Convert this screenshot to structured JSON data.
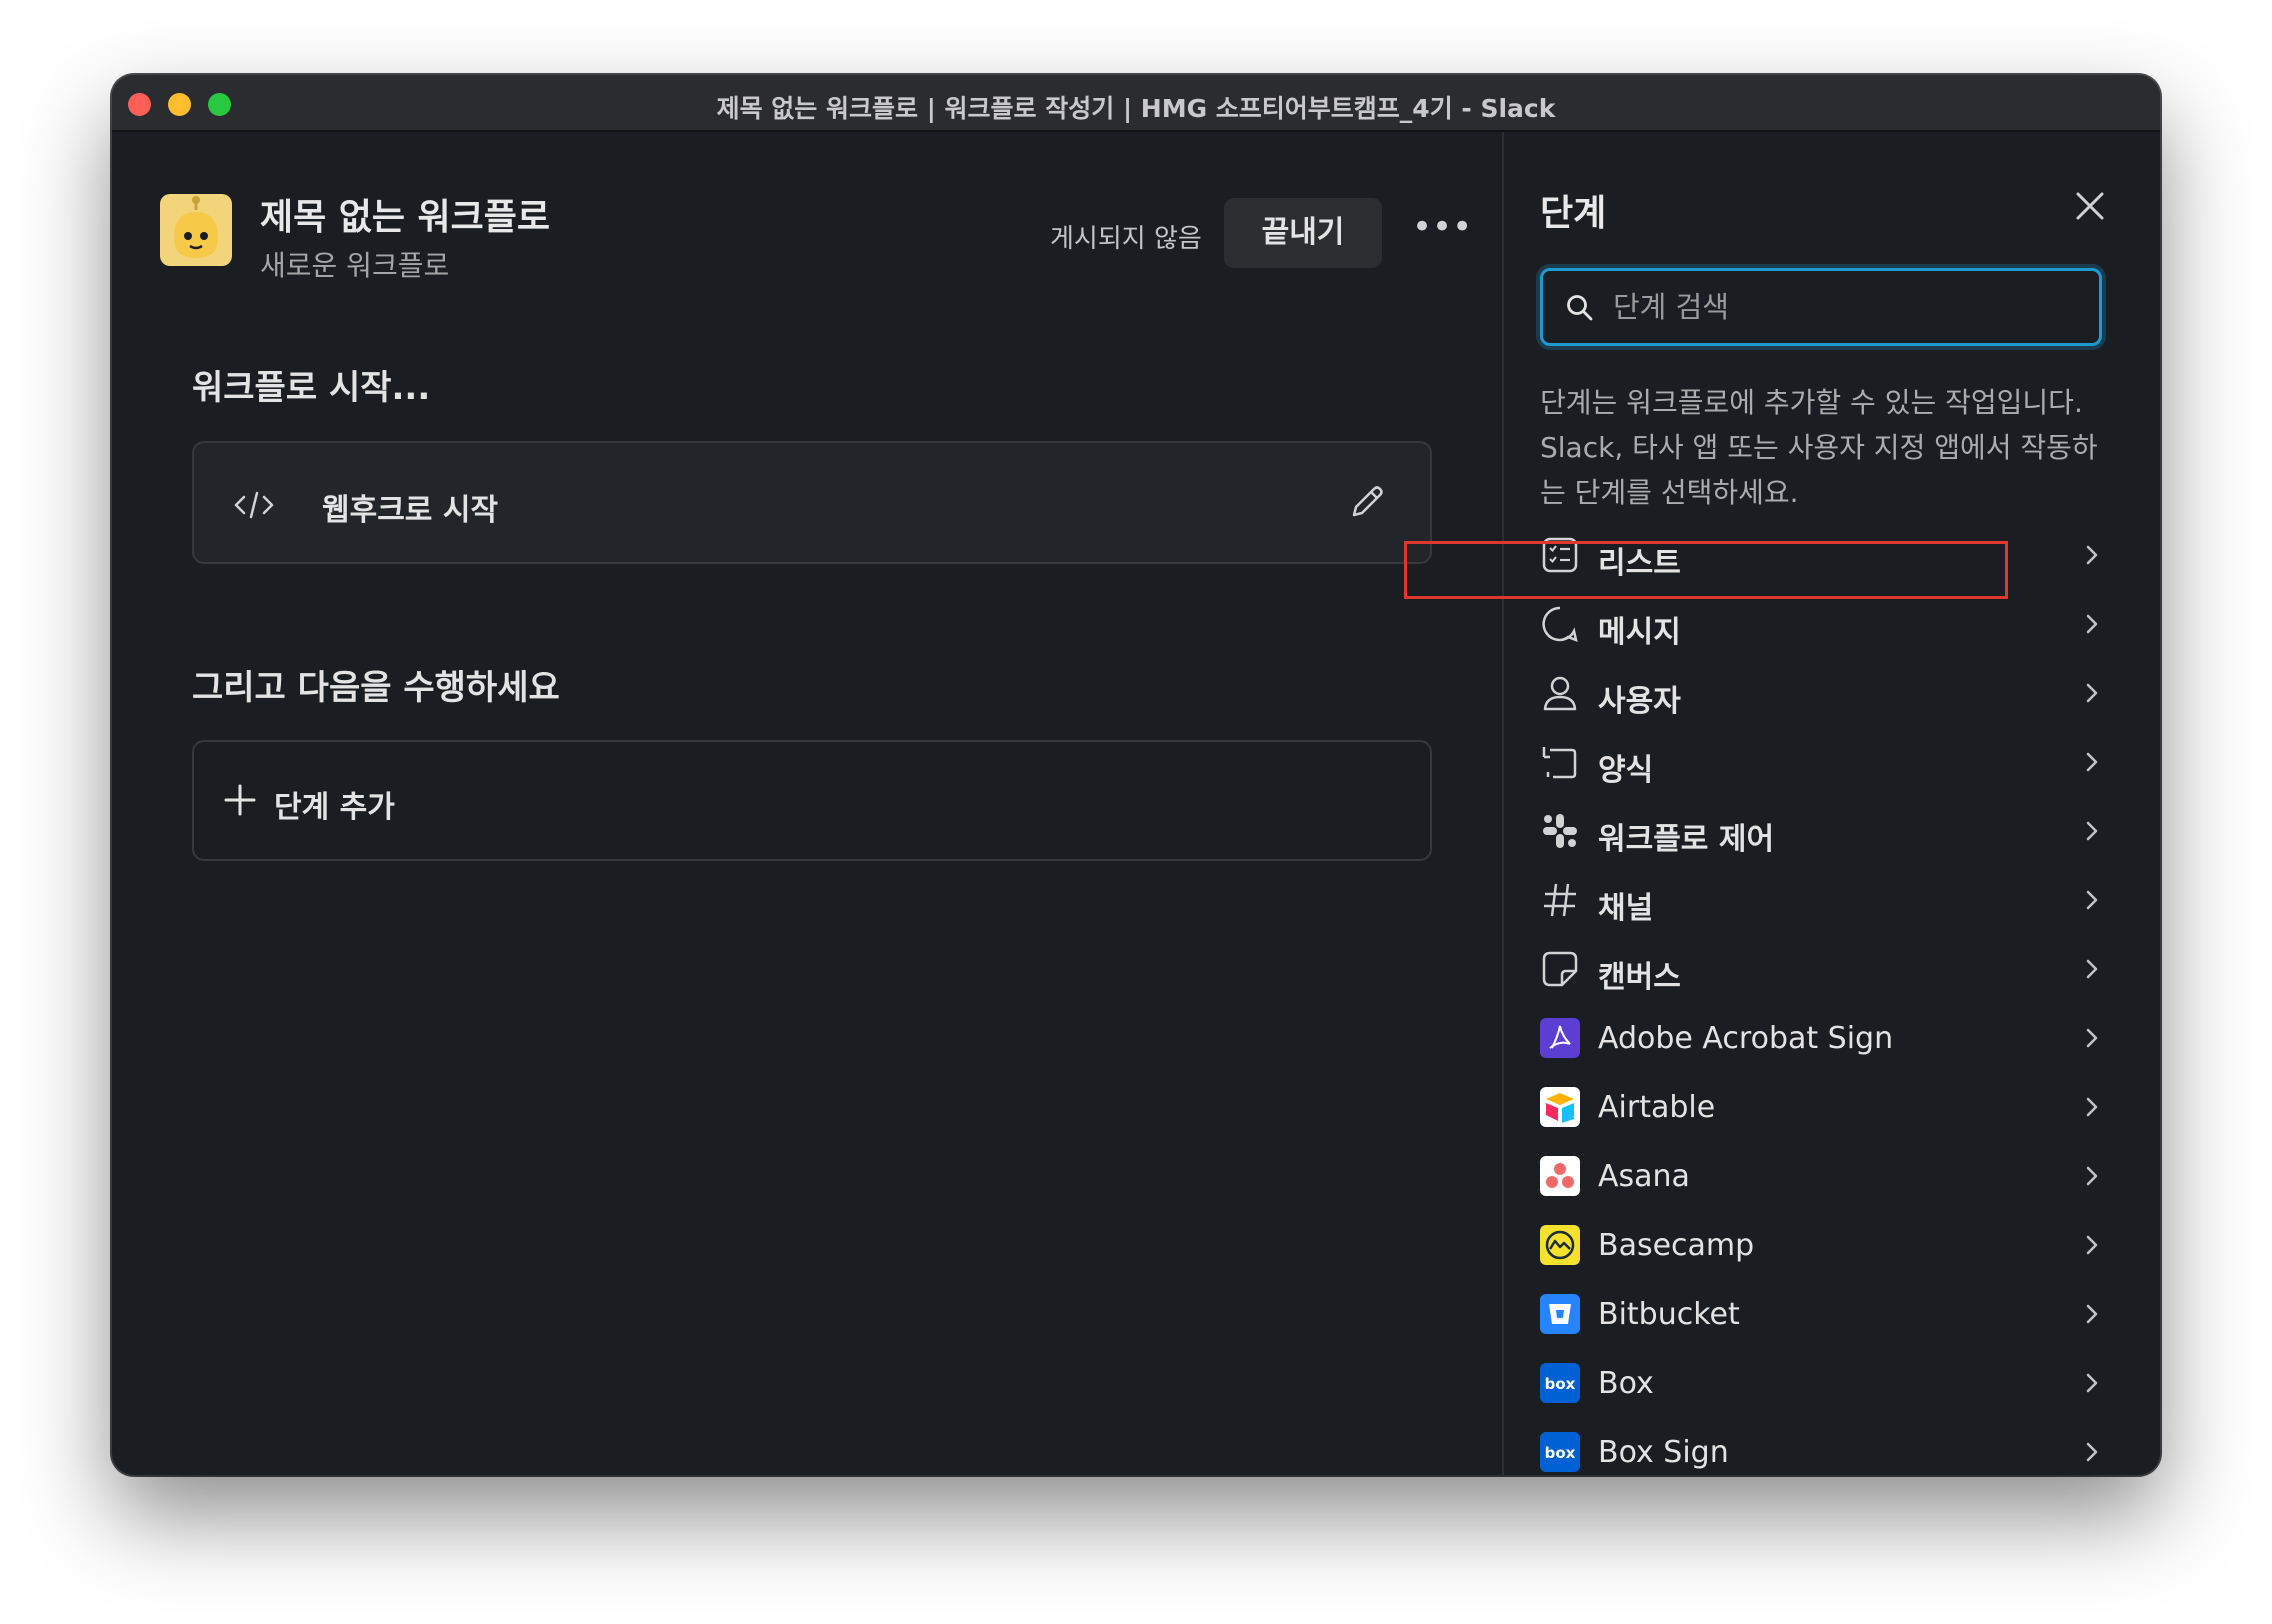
{
  "window": {
    "title": "제목 없는 워크플로 | 워크플로 작성기 | HMG 소프티어부트캠프_4기 - Slack"
  },
  "workflow": {
    "title": "제목 없는 워크플로",
    "subtitle": "새로운 워크플로",
    "status": "게시되지 않음",
    "finish_label": "끝내기",
    "more_label": "•••"
  },
  "start_section": {
    "heading": "워크플로 시작...",
    "trigger_label": "웹후크로 시작"
  },
  "then_section": {
    "heading": "그리고 다음을 수행하세요",
    "add_step_label": "단계 추가"
  },
  "panel": {
    "title": "단계",
    "search_placeholder": "단계 검색",
    "description": "단계는 워크플로에 추가할 수 있는 작업입니다. Slack, 타사 앱 또는 사용자 지정 앱에서 작동하는 단계를 선택하세요.",
    "categories": [
      {
        "label": "리스트",
        "icon": "list-icon"
      },
      {
        "label": "메시지",
        "icon": "message-icon"
      },
      {
        "label": "사용자",
        "icon": "user-icon"
      },
      {
        "label": "양식",
        "icon": "form-icon"
      },
      {
        "label": "워크플로 제어",
        "icon": "workflow-control-icon"
      },
      {
        "label": "채널",
        "icon": "hash-icon"
      },
      {
        "label": "캔버스",
        "icon": "canvas-icon"
      },
      {
        "label": "Adobe Acrobat Sign",
        "icon": "adobe-acrobat-sign-icon"
      },
      {
        "label": "Airtable",
        "icon": "airtable-icon"
      },
      {
        "label": "Asana",
        "icon": "asana-icon"
      },
      {
        "label": "Basecamp",
        "icon": "basecamp-icon"
      },
      {
        "label": "Bitbucket",
        "icon": "bitbucket-icon"
      },
      {
        "label": "Box",
        "icon": "box-icon"
      },
      {
        "label": "Box Sign",
        "icon": "box-sign-icon"
      }
    ],
    "highlighted_category": "메시지"
  },
  "colors": {
    "background": "#1a1d21",
    "accent": "#1d9bd1",
    "highlight": "#e0382e"
  }
}
